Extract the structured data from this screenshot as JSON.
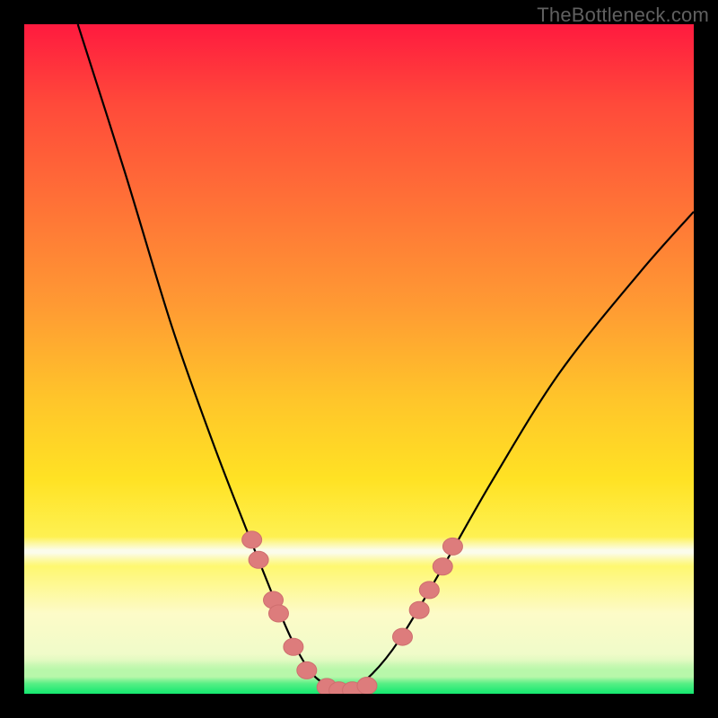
{
  "watermark": "TheBottleneck.com",
  "colors": {
    "frame": "#000000",
    "dot_fill": "#dd7c7c",
    "dot_stroke": "#ce6e6e",
    "curve": "#000000",
    "gradient_top": "#ff1a3f",
    "gradient_mid_orange": "#ff9a33",
    "gradient_yellow": "#ffe224",
    "gradient_light": "#fef764",
    "white_band": "#fbfceb",
    "pale_green": "#b8f7aa",
    "green_bottom": "#14e86f"
  },
  "chart_data": {
    "type": "line",
    "title": "",
    "xlabel": "",
    "ylabel": "",
    "xlim": [
      0,
      100
    ],
    "ylim": [
      0,
      100
    ],
    "series": [
      {
        "name": "curve",
        "x": [
          8,
          15,
          22,
          28,
          33,
          37,
          40,
          43,
          46,
          49,
          52,
          56,
          62,
          70,
          80,
          92,
          100
        ],
        "y": [
          100,
          78,
          55,
          38,
          25,
          15,
          8,
          3,
          1,
          1,
          3,
          8,
          18,
          32,
          48,
          63,
          72
        ]
      }
    ],
    "dots": [
      {
        "x": 34.0,
        "y": 23.0
      },
      {
        "x": 35.0,
        "y": 20.0
      },
      {
        "x": 37.2,
        "y": 14.0
      },
      {
        "x": 38.0,
        "y": 12.0
      },
      {
        "x": 40.2,
        "y": 7.0
      },
      {
        "x": 42.2,
        "y": 3.5
      },
      {
        "x": 45.2,
        "y": 1.0
      },
      {
        "x": 47.0,
        "y": 0.5
      },
      {
        "x": 49.0,
        "y": 0.5
      },
      {
        "x": 51.2,
        "y": 1.2
      },
      {
        "x": 56.5,
        "y": 8.5
      },
      {
        "x": 59.0,
        "y": 12.5
      },
      {
        "x": 60.5,
        "y": 15.5
      },
      {
        "x": 62.5,
        "y": 19.0
      },
      {
        "x": 64.0,
        "y": 22.0
      }
    ],
    "bands": {
      "white_band": {
        "from_y": 19.0,
        "to_y": 23.5
      },
      "pale_green_band": {
        "from_y": 2.5,
        "to_y": 5.0
      },
      "green_bottom": {
        "from_y": 0.0,
        "to_y": 2.5
      }
    }
  }
}
